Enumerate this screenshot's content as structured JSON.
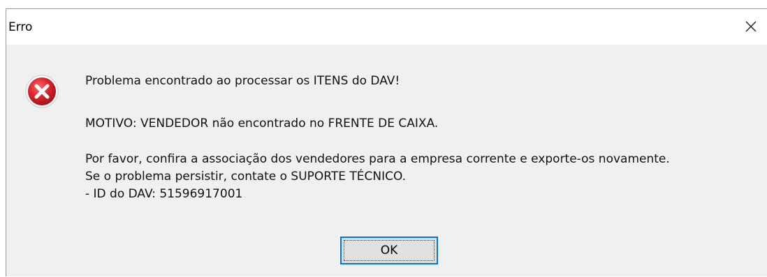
{
  "window": {
    "title": "Erro",
    "close_icon": "close-icon"
  },
  "message": {
    "icon": "error-icon",
    "line1": "Problema encontrado ao processar os ITENS do DAV!",
    "line2": "MOTIVO: VENDEDOR não encontrado no FRENTE DE CAIXA.",
    "line3": "Por favor, confira a associação dos vendedores para a empresa corrente e exporte-os novamente.",
    "line4": "Se o problema persistir, contate o SUPORTE TÉCNICO.",
    "line5": "- ID do DAV: 51596917001"
  },
  "buttons": {
    "ok_label": "OK"
  },
  "colors": {
    "error_red": "#d9262b",
    "focus_blue": "#0078d7",
    "dialog_bg": "#f0f0f0"
  }
}
